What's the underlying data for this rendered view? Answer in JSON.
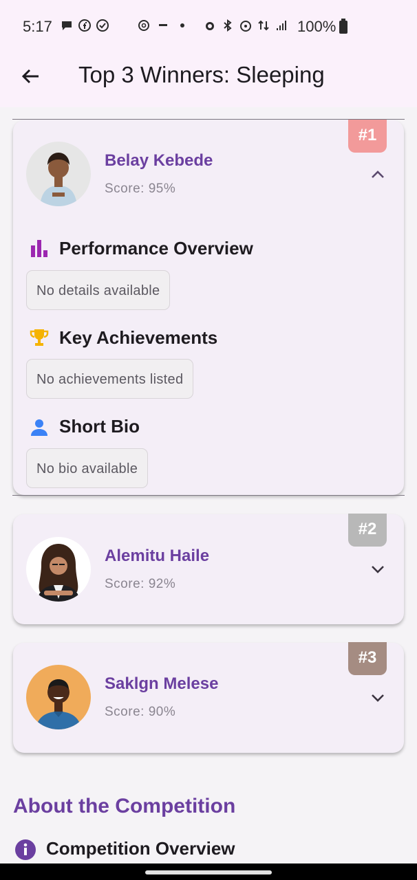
{
  "status_bar": {
    "time": "5:17",
    "battery": "100%"
  },
  "app_bar": {
    "title": "Top 3 Winners: Sleeping"
  },
  "winners": [
    {
      "rank": "#1",
      "badge_color": "#f29a9a",
      "name": "Belay Kebede",
      "score": "Score: 95%",
      "expanded": true,
      "sections": [
        {
          "title": "Performance Overview",
          "icon": "bar-chart-icon",
          "value": "No details available"
        },
        {
          "title": "Key Achievements",
          "icon": "trophy-icon",
          "value": "No achievements listed"
        },
        {
          "title": "Short Bio",
          "icon": "person-icon",
          "value": "No bio available"
        }
      ]
    },
    {
      "rank": "#2",
      "badge_color": "#b8b8b8",
      "name": "Alemitu Haile",
      "score": "Score: 92%",
      "expanded": false
    },
    {
      "rank": "#3",
      "badge_color": "#a58c82",
      "name": "Saklgn Melese",
      "score": "Score: 90%",
      "expanded": false
    }
  ],
  "about": {
    "title": "About the Competition",
    "overview_title": "Competition Overview"
  },
  "colors": {
    "accent": "#6b3fa0",
    "bar_chart": "#9c27b0",
    "trophy": "#f5b301",
    "person": "#3b82f6",
    "info": "#6b3fa0"
  }
}
